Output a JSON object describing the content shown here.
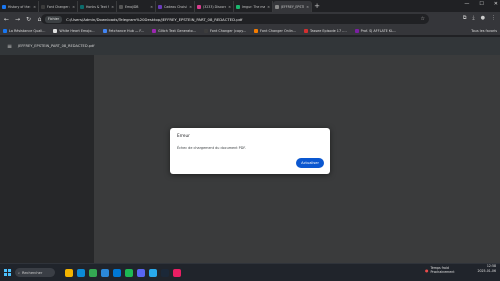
{
  "tabs": [
    {
      "label": "History of the Sri...",
      "color": "#1877f2",
      "active": false
    },
    {
      "label": "Font Changer (co...",
      "color": "#3c3c3c",
      "active": false
    },
    {
      "label": "Honks & Text Sym...",
      "color": "#0b6b6b",
      "active": false
    },
    {
      "label": "EmojiDB",
      "color": "#555555",
      "active": false
    },
    {
      "label": "Cadeau Choisi...",
      "color": "#6a3cbc",
      "active": false
    },
    {
      "label": "(3233) Discord | I...",
      "color": "#d93d8f",
      "active": false
    },
    {
      "label": "Imgur: The magic...",
      "color": "#1bb76e",
      "active": false
    },
    {
      "label": "JEFFREY_EPSTEIN...",
      "color": "#8a8a8a",
      "active": true
    }
  ],
  "address": {
    "chip": "Fichier",
    "url": "C:/Users/Admin/Downloads/Telegram%20Desktop/JEFFREY_EPSTEIN_PART_08_REDACTED.pdf"
  },
  "bookmarks": [
    {
      "label": "La Résistance Quali...",
      "color": "#1877f2"
    },
    {
      "label": "White Heart Emojo...",
      "color": "#e0e0e0"
    },
    {
      "label": "Fetchance Hub — F...",
      "color": "#4285f4"
    },
    {
      "label": "Glitch Text Generato...",
      "color": "#9c27b0"
    },
    {
      "label": "Font Changer (copy...",
      "color": "#3c3c3c"
    },
    {
      "label": "Font Changer Onlin...",
      "color": "#f57c00"
    },
    {
      "label": "Tassee Episode 17 -...",
      "color": "#d32f2f"
    },
    {
      "label": "Prof. SJ AFFLATE KL...",
      "color": "#7b1fa2"
    }
  ],
  "bookmarks_all": "Tous les favoris",
  "pdf": {
    "filename": "JEFFREY_EPSTEIN_PART_08_REDACTED.pdf"
  },
  "dialog": {
    "title": "Erreur",
    "message": "Échec de chargement du document PDF.",
    "button": "Actualiser"
  },
  "taskbar": {
    "search_placeholder": "Rechercher",
    "apps": [
      {
        "name": "explorer",
        "color": "#f4b400"
      },
      {
        "name": "edge",
        "color": "#0c8bd6"
      },
      {
        "name": "chrome",
        "color": "#34a853"
      },
      {
        "name": "store",
        "color": "#2b88d8"
      },
      {
        "name": "mail",
        "color": "#0078d4"
      },
      {
        "name": "spotify",
        "color": "#1db954"
      },
      {
        "name": "discord",
        "color": "#5865f2"
      },
      {
        "name": "telegram",
        "color": "#29a9eb"
      },
      {
        "name": "steam",
        "color": "#1b2838"
      },
      {
        "name": "photos",
        "color": "#e91e63"
      }
    ]
  },
  "weather": {
    "line1": "Temps froid",
    "line2": "Prochainement"
  },
  "clock": {
    "time": "12:58",
    "date": "2025-01-06"
  }
}
